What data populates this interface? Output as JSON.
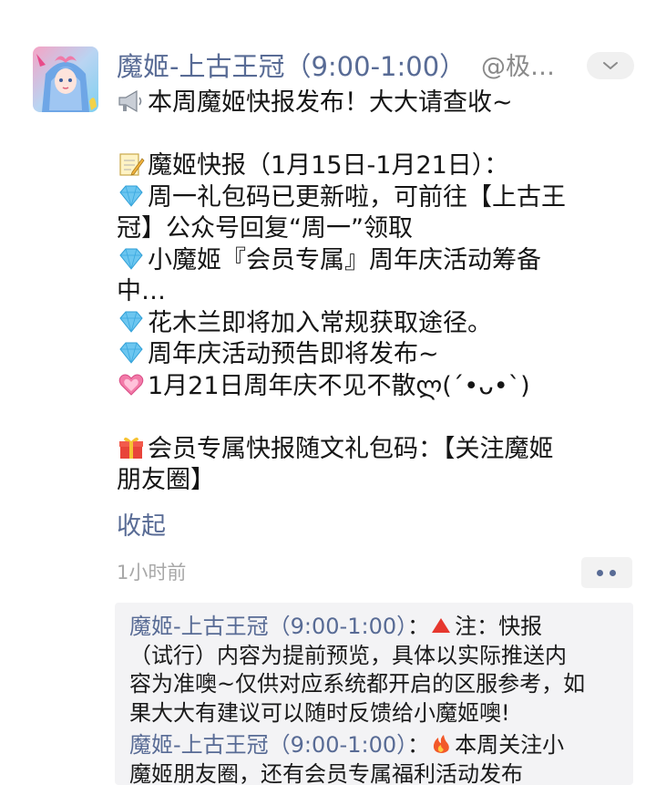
{
  "post": {
    "author": "魔姬-上古王冠（9:00-1:00）",
    "handle": "@极…",
    "paragraphs": [
      {
        "icon": "megaphone-icon",
        "text": "本周魔姬快报发布！大大请查收~"
      },
      {
        "icon": "memo-icon",
        "text": "魔姬快报（1月15日-1月21日）："
      },
      {
        "icon": "diamond-icon",
        "text": "周一礼包码已更新啦，可前往【上古王",
        "cont": "冠】公众号回复“周一”领取"
      },
      {
        "icon": "diamond-icon",
        "text": "小魔姬『会员专属』周年庆活动筹备",
        "cont": "中…"
      },
      {
        "icon": "diamond-icon",
        "text": "花木兰即将加入常规获取途径。"
      },
      {
        "icon": "diamond-icon",
        "text": "周年庆活动预告即将发布~"
      },
      {
        "icon": "heart-icon",
        "text": "1月21日周年庆不见不散ლ(´•ᴗ•`)"
      },
      {
        "icon": "gift-icon",
        "text": "会员专属快报随文礼包码：【关注魔姬",
        "cont": "朋友圈】"
      }
    ],
    "collapse_label": "收起",
    "timestamp": "1小时前"
  },
  "comments": [
    {
      "author": "魔姬-上古王冠（9:00-1:00）",
      "separator": "：",
      "icon": "triangle-icon",
      "lines": [
        "注：快报",
        "（试行）内容为提前预览，具体以实际推送内",
        "容为准噢~仅供对应系统都开启的区服参考，如",
        "果大大有建议可以随时反馈给小魔姬噢!"
      ]
    },
    {
      "author": "魔姬-上古王冠（9:00-1:00）",
      "separator": "：",
      "icon": "fire-icon",
      "lines": [
        "本周关注小",
        "魔姬朋友圈，还有会员专属福利活动发布"
      ]
    }
  ],
  "colors": {
    "link": "#586b95",
    "text": "#151515",
    "muted": "#a8a8a8",
    "comment_bg": "#f3f3f5"
  }
}
